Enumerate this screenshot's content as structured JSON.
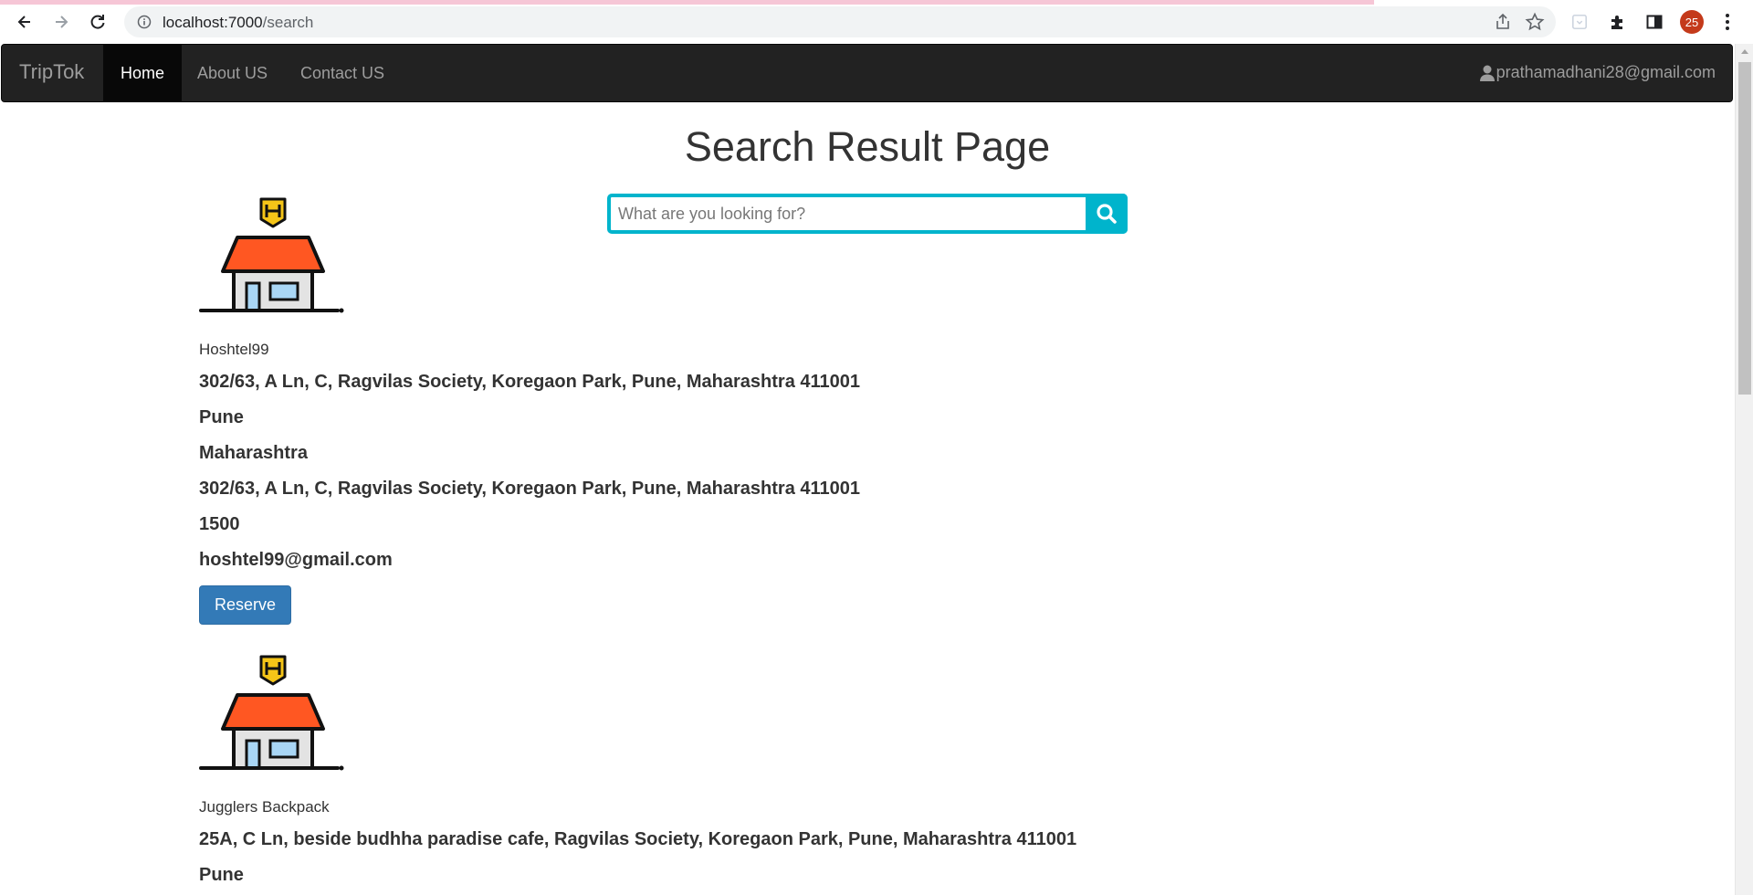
{
  "browser": {
    "url_host": "localhost:7000",
    "url_path": "/search",
    "profile_badge": "25"
  },
  "navbar": {
    "brand": "TripTok",
    "links": [
      {
        "label": "Home",
        "active": true
      },
      {
        "label": "About US",
        "active": false
      },
      {
        "label": "Contact US",
        "active": false
      }
    ],
    "user_email": "prathamadhani28@gmail.com"
  },
  "page": {
    "title": "Search Result Page",
    "search_placeholder": "What are you looking for?"
  },
  "results": [
    {
      "name": "Hoshtel99",
      "address": "302/63, A Ln, C, Ragvilas Society, Koregaon Park, Pune, Maharashtra 411001",
      "city": "Pune",
      "state": "Maharashtra",
      "address2": "302/63, A Ln, C, Ragvilas Society, Koregaon Park, Pune, Maharashtra 411001",
      "price": "1500",
      "email": "hoshtel99@gmail.com",
      "reserve_label": "Reserve"
    },
    {
      "name": "Jugglers Backpack",
      "address": "25A, C Ln, beside budhha paradise cafe, Ragvilas Society, Koregaon Park, Pune, Maharashtra 411001",
      "city": "Pune"
    }
  ],
  "colors": {
    "navbar_bg": "#222222",
    "search_accent": "#00b4cc",
    "button_primary": "#337ab7",
    "hotel_roof": "#ff5722",
    "hotel_sign": "#f5c518"
  },
  "icons": {
    "back": "back-arrow-icon",
    "forward": "forward-arrow-icon",
    "reload": "reload-icon",
    "info": "info-icon",
    "share": "share-icon",
    "bookmark": "star-icon",
    "extensions": "puzzle-icon",
    "side_panel": "side-panel-icon",
    "menu": "kebab-menu-icon",
    "user": "user-icon",
    "search": "search-icon",
    "hotel": "hotel-house-icon"
  }
}
